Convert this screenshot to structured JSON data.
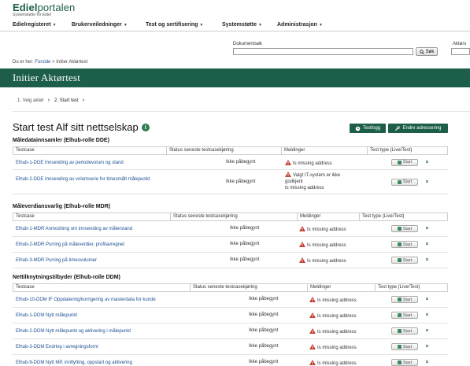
{
  "logo": {
    "name_bold": "Ediel",
    "name_rest": "portalen",
    "tagline": "Systemstøtte for Ediel"
  },
  "nav": [
    {
      "label": "Edielregisteret"
    },
    {
      "label": "Brukerveiledninger"
    },
    {
      "label": "Test og sertifisering"
    },
    {
      "label": "Systemstøtte"
    },
    {
      "label": "Administrasjon"
    }
  ],
  "search": {
    "label": "Dokumentsøk",
    "value": "",
    "button": "Søk",
    "label2": "Aktørs"
  },
  "breadcrumb": {
    "prefix": "Du er her:",
    "home": "Forside",
    "divider": ">",
    "current": "Initier Aktørtest"
  },
  "page": {
    "title": "Initier Aktørtest",
    "heading": "Start test Alf sitt nettselskap",
    "info_icon": "info-icon"
  },
  "steps": [
    {
      "label": "1. Velg aktør",
      "active": false
    },
    {
      "label": "2. Start test",
      "active": true
    }
  ],
  "actions": {
    "testlog": "Testlogg",
    "adressing": "Endre adressering"
  },
  "sections": [
    {
      "title": "Måledatainnsamler (Elhub-rolle DDE)",
      "headers": [
        "Testcase",
        "Status seneste testcasekjøring",
        "Meldinger",
        "Test type (Live/Test)"
      ],
      "rows": [
        {
          "name": "Elhub-1-DDE Innsending av periodevolum og stand",
          "status": "Ikke påbegynt",
          "message": "Is missing address",
          "message_extra": [],
          "start": "Start"
        },
        {
          "name": "Elhub-2-DDE Innsending av volumserie for timesmålt målepunkt",
          "status": "Ikke påbegynt",
          "message": "Valgt IT-system er ikke godkjent",
          "message_extra": [
            "Is missing address"
          ],
          "start": "Start"
        }
      ]
    },
    {
      "title": "Måleverdiansvarlig (Elhub-rolle MDR)",
      "headers": [
        "Testcase",
        "Status seneste testcasekjøring",
        "Meldinger",
        "Test type (Live/Test)"
      ],
      "rows": [
        {
          "name": "Elhub-1-MDR Anmodning om innsending av målerstand",
          "status": "Ikke påbegynt",
          "message": "Is missing address",
          "message_extra": [],
          "start": "Start"
        },
        {
          "name": "Elhub-2-MDR Purring på måleverdier, profilavregnet",
          "status": "Ikke påbegynt",
          "message": "Is missing address",
          "message_extra": [],
          "start": "Start"
        },
        {
          "name": "Elhub-3-MDR Purring på timesvolumer",
          "status": "Ikke påbegynt",
          "message": "Is missing address",
          "message_extra": [],
          "start": "Start"
        }
      ]
    },
    {
      "title": "Nettilknytningstilbyder (Elhub-rolle DDM)",
      "headers": [
        "Testcase",
        "Status seneste testcasekjøring",
        "Meldinger",
        "Test type (Live/Test)"
      ],
      "rows": [
        {
          "name": "Elhub-10-DDM IF Oppdatering/korrigering av masterdata for kunde",
          "status": "Ikke påbegynt",
          "message": "Is missing address",
          "message_extra": [],
          "start": "Start"
        },
        {
          "name": "Elhub-1-DDM Nytt målepunkt",
          "status": "Ikke påbegynt",
          "message": "Is missing address",
          "message_extra": [],
          "start": "Start"
        },
        {
          "name": "Elhub-2-DDM Nytt målepunkt og aktivering i målepunkt",
          "status": "Ikke påbegynt",
          "message": "Is missing address",
          "message_extra": [],
          "start": "Start"
        },
        {
          "name": "Elhub-3-DDM Endring i avregningsform",
          "status": "Ikke påbegynt",
          "message": "Is missing address",
          "message_extra": [],
          "start": "Start"
        },
        {
          "name": "Elhub-9-DDM Nytt MP, innflytting, oppstart og aktivering",
          "status": "Ikke påbegynt",
          "message": "Is missing address",
          "message_extra": [],
          "start": "Start"
        }
      ]
    }
  ],
  "colors": {
    "brand": "#1d5e4b",
    "link": "#1d4f91",
    "warning": "#c0392b"
  }
}
